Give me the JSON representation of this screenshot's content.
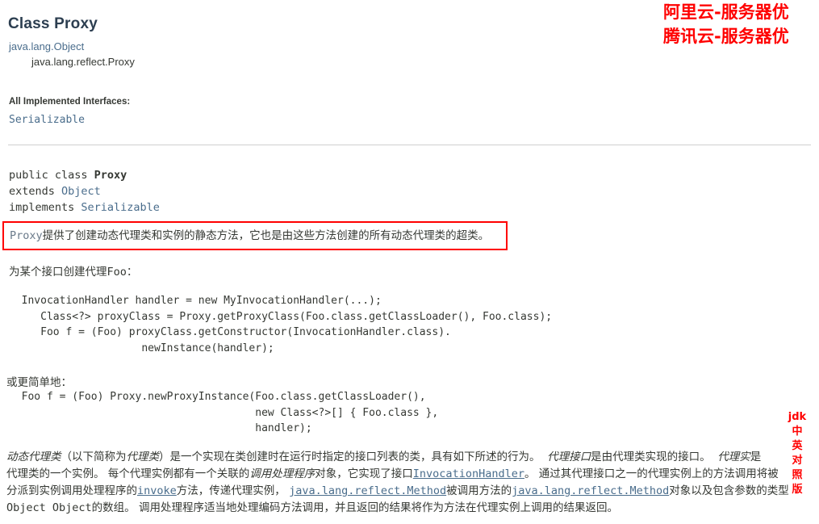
{
  "page": {
    "title": "Class Proxy"
  },
  "inheritance": {
    "parent": "java.lang.Object",
    "child": "java.lang.reflect.Proxy"
  },
  "interfaces": {
    "heading": "All Implemented Interfaces:",
    "items": "Serializable"
  },
  "declaration": {
    "line1_prefix": "public class ",
    "line1_name": "Proxy",
    "line2_prefix": "extends ",
    "line2_type": "Object",
    "line3_prefix": "implements ",
    "line3_type": "Serializable"
  },
  "highlight": {
    "code_word": "Proxy",
    "text": "提供了创建动态代理类和实例的静态方法，它也是由这些方法创建的所有动态代理类的超类。",
    "border_color": "#ff0000"
  },
  "sections": {
    "lead1_cn": "为某个接口创建代理",
    "lead1_code": "Foo",
    "lead1_colon": "：",
    "code1": "  InvocationHandler handler = new MyInvocationHandler(...);\n     Class<?> proxyClass = Proxy.getProxyClass(Foo.class.getClassLoader(), Foo.class);\n     Foo f = (Foo) proxyClass.getConstructor(InvocationHandler.class).\n                     newInstance(handler);",
    "lead2": "或更简单地：",
    "code2": "  Foo f = (Foo) Proxy.newProxyInstance(Foo.class.getClassLoader(),\n                                       new Class<?>[] { Foo.class },\n                                       handler);"
  },
  "description": {
    "line1": {
      "i1": "动态代理类",
      "t1": "（以下简称为",
      "i2": "代理类",
      "t2": "）是一个实现在类创建时在运行时指定的接口列表的类，具有如下所述的行为。",
      "i3": "代理接口",
      "t3": "是由代理类实现的接口。",
      "i4": "代理实",
      "t4": "是"
    },
    "line2": {
      "t1": "代理类的一个实例。 每个代理实例都有一个关联的",
      "i1": "调用处理程序",
      "t2": "对象，它实现了接口",
      "lk1": "InvocationHandler",
      "t3": "。 通过其代理接口之一的代理实例上的方法调用将被"
    },
    "line3": {
      "t1": "分派到实例调用处理程序的",
      "lk1": "invoke",
      "t2": "方法，传递代理实例，",
      "lk2": "java.lang.reflect.Method",
      "t3": "被调用方法的",
      "lk3": "java.lang.reflect.Method",
      "t4": "对象以及包含参数的类型"
    },
    "line4": {
      "lk1": "Object Object",
      "t1": "的数组。 调用处理程序适当地处理编码方法调用，并且返回的结果将作为方法在代理实例上调用的结果返回。"
    }
  },
  "watermarks": {
    "top_line1": "阿里云-服务器优",
    "top_line2": "腾讯云-服务器优",
    "side_chars": [
      "jdk",
      "中",
      "英",
      "对",
      "照",
      "版"
    ],
    "color": "#ff0000"
  }
}
